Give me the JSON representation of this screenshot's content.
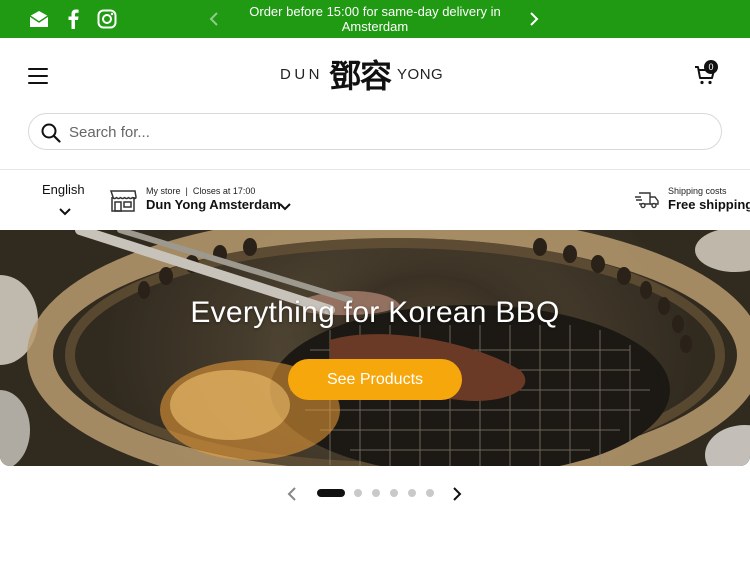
{
  "announcement": {
    "message": "Order before 15:00 for same-day delivery in Amsterdam",
    "background": "#1f9a12"
  },
  "social": [
    {
      "icon": "mail-icon"
    },
    {
      "icon": "facebook-icon"
    },
    {
      "icon": "instagram-icon"
    }
  ],
  "header": {
    "logo_left": "DUN",
    "logo_chinese": "鄧容",
    "logo_right": "YONG",
    "cart_count": "0"
  },
  "search": {
    "placeholder": "Search for..."
  },
  "infobar": {
    "language": "English",
    "store_status": "My store  |  Closes at 17:00",
    "store_name": "Dun Yong Amsterdam",
    "shipping_label": "Shipping costs",
    "shipping_value": "Free shipping"
  },
  "hero": {
    "title": "Everything for Korean BBQ",
    "button_label": "See Products",
    "button_color": "#f6a70b"
  },
  "slider": {
    "total_slides": 6,
    "active_index": 0
  }
}
